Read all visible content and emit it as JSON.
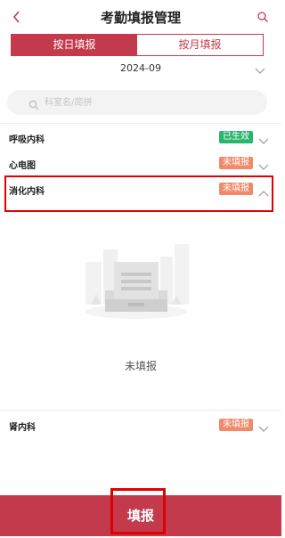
{
  "header": {
    "title": "考勤填报管理",
    "back_icon": "chevron-left-icon",
    "search_icon": "search-icon"
  },
  "tabs": [
    {
      "label": "按日填报",
      "active": true
    },
    {
      "label": "按月填报",
      "active": false
    }
  ],
  "month": {
    "value": "2024-09"
  },
  "search": {
    "placeholder": "科室名/简拼"
  },
  "departments": [
    {
      "name": "呼吸内科",
      "status": "已生效",
      "status_color": "#2bb46b",
      "expanded": false
    },
    {
      "name": "心电图",
      "status": "未填报",
      "status_color": "#f08a6a",
      "expanded": false
    },
    {
      "name": "消化内科",
      "status": "未填报",
      "status_color": "#f08a6a",
      "expanded": true
    },
    {
      "name": "肾内科",
      "status": "未填报",
      "status_color": "#f08a6a",
      "expanded": false
    }
  ],
  "empty_state": {
    "text": "未填报"
  },
  "footer": {
    "submit_label": "填报"
  },
  "colors": {
    "accent": "#c23a4b",
    "highlight": "#e00000"
  }
}
